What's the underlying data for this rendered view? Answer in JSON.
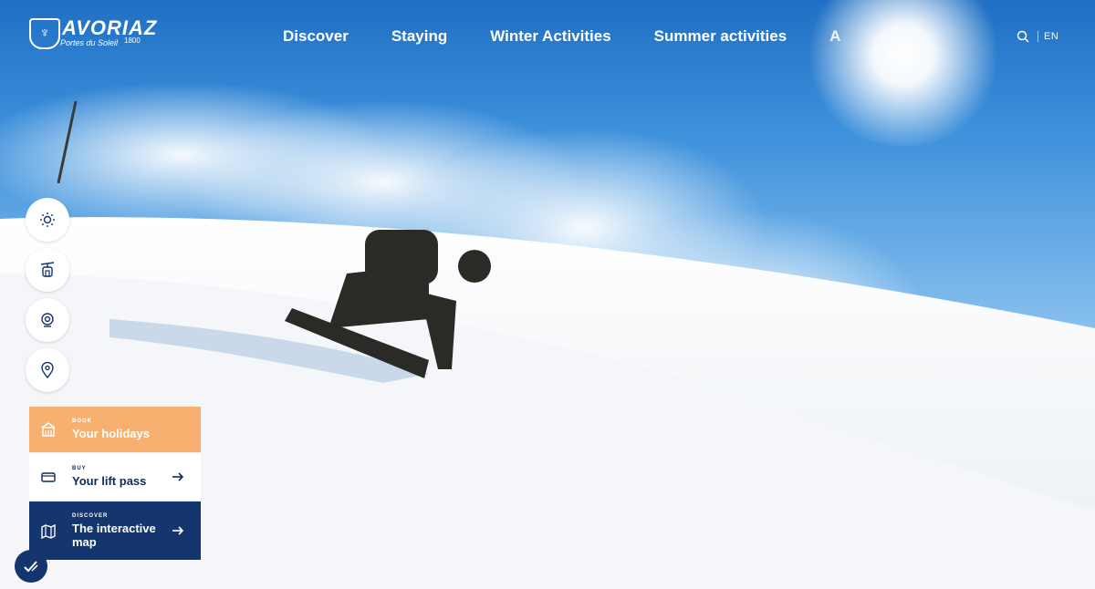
{
  "brand": {
    "name": "AVORIAZ",
    "subtitle": "Portes du Soleil",
    "altitude": "1800"
  },
  "nav": {
    "items": [
      "Discover",
      "Staying",
      "Winter Activities",
      "Summer activities",
      "A"
    ]
  },
  "header": {
    "language": "EN"
  },
  "side_buttons": [
    {
      "icon": "sun-icon"
    },
    {
      "icon": "cable-car-icon"
    },
    {
      "icon": "webcam-icon"
    },
    {
      "icon": "location-pin-icon"
    }
  ],
  "cards": {
    "holidays": {
      "kicker": "BOOK",
      "title": "Your holidays"
    },
    "lift": {
      "kicker": "BUY",
      "title": "Your lift pass"
    },
    "map": {
      "kicker": "DISCOVER",
      "title": "The interactive map"
    }
  },
  "colors": {
    "orange": "#f7b06f",
    "navy": "#14356e",
    "sky": "#3d90db"
  }
}
